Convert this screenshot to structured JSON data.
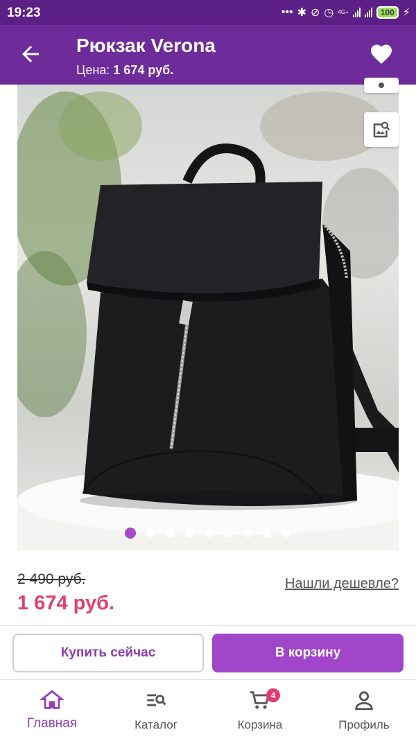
{
  "status_bar": {
    "time": "19:23",
    "network": "4G+",
    "battery": "100"
  },
  "header": {
    "title": "Рюкзак Verona",
    "price_label": "Цена:",
    "price_value": "1 674 руб."
  },
  "gallery": {
    "dot_count": 9,
    "active_index": 0
  },
  "pricing": {
    "old_price": "2 490 руб.",
    "new_price": "1 674 руб.",
    "found_cheaper_link": "Нашли дешевле?"
  },
  "actions": {
    "buy_now": "Купить сейчас",
    "add_to_cart": "В корзину"
  },
  "bottom_nav": {
    "items": [
      {
        "label": "Главная",
        "icon": "home-icon",
        "active": true
      },
      {
        "label": "Каталог",
        "icon": "catalog-search-icon",
        "active": false
      },
      {
        "label": "Корзина",
        "icon": "cart-icon",
        "active": false,
        "badge": "4"
      },
      {
        "label": "Профиль",
        "icon": "profile-icon",
        "active": false
      }
    ]
  },
  "colors": {
    "app_bar": "#6e2b9a",
    "status_bar": "#5c1f86",
    "accent": "#a146c8",
    "sale_price": "#e13f6f",
    "badge": "#e63a6f"
  }
}
